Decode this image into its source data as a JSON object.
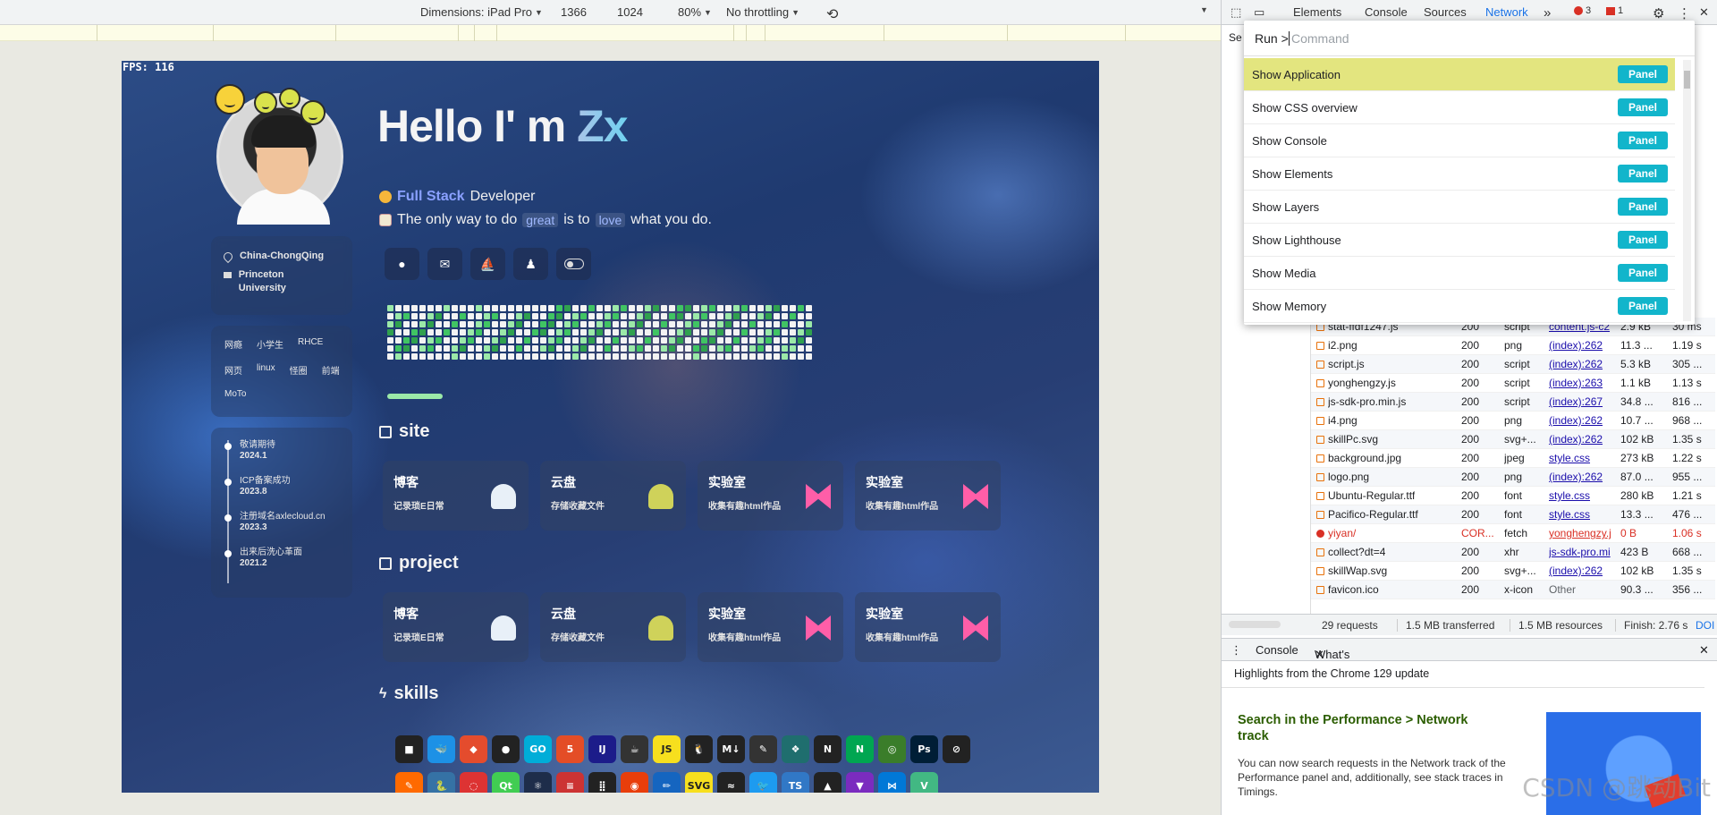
{
  "device_toolbar": {
    "dimensions_label": "Dimensions: iPad Pro",
    "width": "1366",
    "height": "1024",
    "zoom": "80%",
    "throttle": "No throttling"
  },
  "page": {
    "fps": "FPS: 116",
    "hello": "Hello I' m ",
    "hello_name": "Zx",
    "role_highlight": "Full Stack",
    "role_rest": "Developer",
    "quote_a": "The only way to do",
    "quote_great": "great",
    "quote_b": "is to",
    "quote_love": "love",
    "quote_c": "what you do.",
    "location": "China-ChongQing",
    "school": "Princeton University",
    "tags": [
      "网瘾",
      "小学生",
      "RHCE",
      "网页",
      "linux",
      "怪圈",
      "前端",
      "MoTo"
    ],
    "timeline": [
      {
        "title": "敬请期待",
        "date": "2024.1"
      },
      {
        "title": "ICP备案成功",
        "date": "2023.8"
      },
      {
        "title": "注册域名axlecloud.cn",
        "date": "2023.3"
      },
      {
        "title": "出来后洗心革面",
        "date": "2021.2"
      }
    ],
    "section_site": "site",
    "section_project": "project",
    "section_skills": "skills",
    "site_tiles": [
      {
        "title": "博客",
        "desc": "记录琐E日常"
      },
      {
        "title": "云盘",
        "desc": "存储收藏文件"
      },
      {
        "title": "实验室",
        "desc": "收集有趣html作品"
      },
      {
        "title": "实验室",
        "desc": "收集有趣html作品"
      }
    ],
    "project_tiles": [
      {
        "title": "博客",
        "desc": "记录琐E日常"
      },
      {
        "title": "云盘",
        "desc": "存储收藏文件"
      },
      {
        "title": "实验室",
        "desc": "收集有趣html作品"
      },
      {
        "title": "实验室",
        "desc": "收集有趣html作品"
      }
    ],
    "skills_row1": [
      "■",
      "🐳",
      "◆",
      "●",
      "GO",
      "5",
      "IJ",
      "☕",
      "JS",
      "🐧",
      "M↓",
      "✎",
      "❖",
      "N",
      "N",
      "◎",
      "Ps",
      "⊘"
    ],
    "skills_row2": [
      "✎",
      "🐍",
      "◌",
      "Qt",
      "⚛",
      "≡",
      "⣿",
      "◉",
      "✏",
      "SVG",
      "≈",
      "🐦",
      "TS",
      "▲",
      "▼",
      "⋈",
      "V"
    ]
  },
  "devtools": {
    "tabs": [
      "Elements",
      "Console",
      "Sources",
      "Network"
    ],
    "more": "»",
    "errors": "3",
    "warnings": "1",
    "side_label": "Se",
    "palette": {
      "prefix": "Run >",
      "placeholder": "Command",
      "items": [
        {
          "label": "Show Application",
          "button": "Panel"
        },
        {
          "label": "Show CSS overview",
          "button": "Panel"
        },
        {
          "label": "Show Console",
          "button": "Panel"
        },
        {
          "label": "Show Elements",
          "button": "Panel"
        },
        {
          "label": "Show Layers",
          "button": "Panel"
        },
        {
          "label": "Show Lighthouse",
          "button": "Panel"
        },
        {
          "label": "Show Media",
          "button": "Panel"
        },
        {
          "label": "Show Memory",
          "button": "Panel"
        }
      ]
    },
    "network_rows": [
      {
        "name": "stat-ffdf1247.js",
        "status": "200",
        "type": "script",
        "initiator": "content.js-c2",
        "size": "2.9 kB",
        "time": "30 ms"
      },
      {
        "name": "i2.png",
        "status": "200",
        "type": "png",
        "initiator": "(index):262",
        "size": "11.3 ...",
        "time": "1.19 s"
      },
      {
        "name": "script.js",
        "status": "200",
        "type": "script",
        "initiator": "(index):262",
        "size": "5.3 kB",
        "time": "305 ..."
      },
      {
        "name": "yonghengzy.js",
        "status": "200",
        "type": "script",
        "initiator": "(index):263",
        "size": "1.1 kB",
        "time": "1.13 s"
      },
      {
        "name": "js-sdk-pro.min.js",
        "status": "200",
        "type": "script",
        "initiator": "(index):267",
        "size": "34.8 ...",
        "time": "816 ..."
      },
      {
        "name": "i4.png",
        "status": "200",
        "type": "png",
        "initiator": "(index):262",
        "size": "10.7 ...",
        "time": "968 ..."
      },
      {
        "name": "skillPc.svg",
        "status": "200",
        "type": "svg+...",
        "initiator": "(index):262",
        "size": "102 kB",
        "time": "1.35 s"
      },
      {
        "name": "background.jpg",
        "status": "200",
        "type": "jpeg",
        "initiator": "style.css",
        "size": "273 kB",
        "time": "1.22 s"
      },
      {
        "name": "logo.png",
        "status": "200",
        "type": "png",
        "initiator": "(index):262",
        "size": "87.0 ...",
        "time": "955 ..."
      },
      {
        "name": "Ubuntu-Regular.ttf",
        "status": "200",
        "type": "font",
        "initiator": "style.css",
        "size": "280 kB",
        "time": "1.21 s"
      },
      {
        "name": "Pacifico-Regular.ttf",
        "status": "200",
        "type": "font",
        "initiator": "style.css",
        "size": "13.3 ...",
        "time": "476 ..."
      },
      {
        "name": "yiyan/",
        "status": "COR...",
        "type": "fetch",
        "initiator": "yonghengzy.j",
        "size": "0 B",
        "time": "1.06 s",
        "error": true
      },
      {
        "name": "collect?dt=4",
        "status": "200",
        "type": "xhr",
        "initiator": "js-sdk-pro.mi",
        "size": "423 B",
        "time": "668 ..."
      },
      {
        "name": "skillWap.svg",
        "status": "200",
        "type": "svg+...",
        "initiator": "(index):262",
        "size": "102 kB",
        "time": "1.35 s"
      },
      {
        "name": "favicon.ico",
        "status": "200",
        "type": "x-icon",
        "initiator": "Other",
        "size": "90.3 ...",
        "time": "356 ..."
      }
    ],
    "summary": {
      "requests": "29 requests",
      "transferred": "1.5 MB transferred",
      "resources": "1.5 MB resources",
      "finish": "Finish: 2.76 s",
      "dom": "DOI"
    },
    "drawer": {
      "console_tab": "Console",
      "whatsnew_tab": "What's new",
      "highlight": "Highlights from the Chrome 129 update",
      "title": "Search in the Performance > Network track",
      "body": "You can now search requests in the Network track of the Performance panel and, additionally, see stack traces in Timings."
    },
    "watermark": "CSDN @跳动Bit"
  }
}
